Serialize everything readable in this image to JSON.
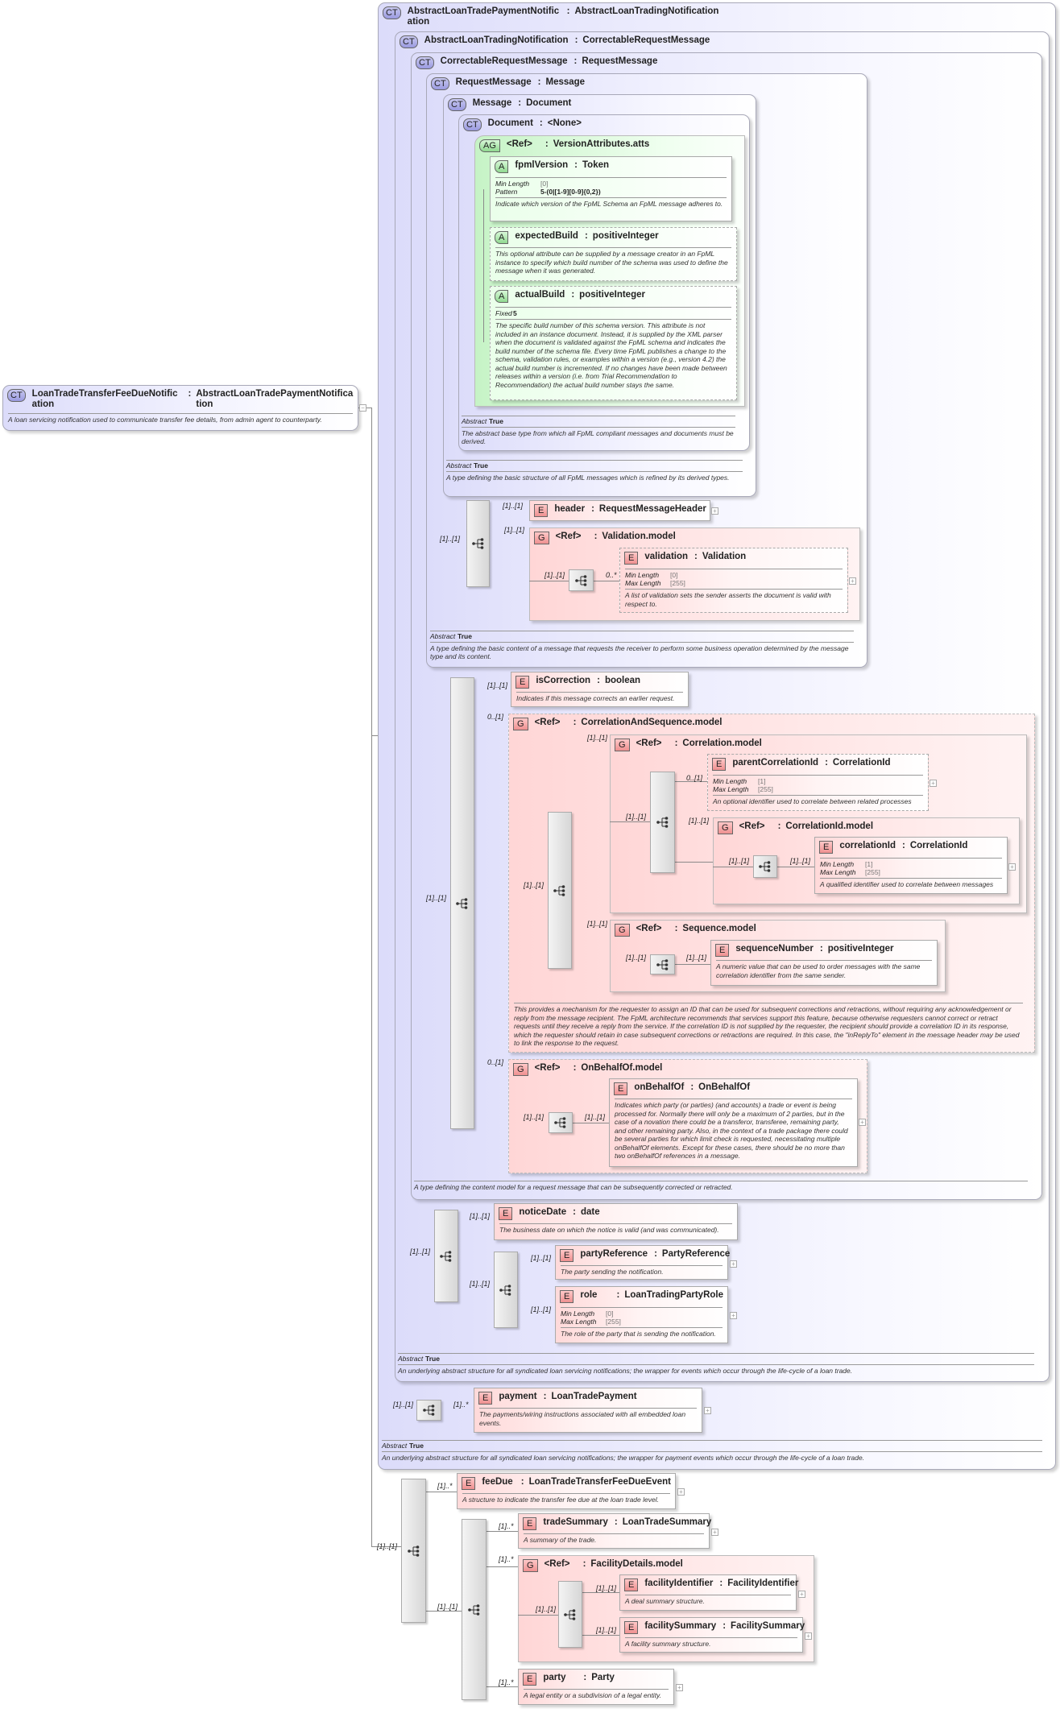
{
  "badges": {
    "ct": "CT",
    "e": "E",
    "g": "G",
    "a": "A",
    "ag": "AG"
  },
  "colon": ":",
  "plus": "+",
  "minus": "−",
  "root": {
    "name": "LoanTradeTransferFeeDueNotification",
    "type": "AbstractLoanTradePaymentNotification",
    "desc": "A loan servicing notification used to communicate transfer fee details, from admin agent to counterparty."
  },
  "abstract_label": "Abstract",
  "abstract_value": "True",
  "types": {
    "paymentNotification": {
      "name": "AbstractLoanTradePaymentNotification",
      "type": "AbstractLoanTradingNotification",
      "desc": "An underlying abstract structure for all syndicated loan servicing notifications; the wrapper for payment events which occur through the life-cycle of a loan trade."
    },
    "tradingNotification": {
      "name": "AbstractLoanTradingNotification",
      "type": "CorrectableRequestMessage",
      "desc": "An underlying abstract structure for all syndicated loan servicing notifications; the wrapper for events which occur through the life-cycle of a loan trade."
    },
    "correctable": {
      "name": "CorrectableRequestMessage",
      "type": "RequestMessage",
      "desc": "A type defining the content model for a request message that can be subsequently corrected or retracted."
    },
    "requestMessage": {
      "name": "RequestMessage",
      "type": "Message",
      "desc": "A type defining the basic content of a message that requests the receiver to perform some business operation determined by the message type and its content."
    },
    "message": {
      "name": "Message",
      "type": "Document",
      "desc": "A type defining the basic structure of all FpML messages which is refined by its derived types."
    },
    "document": {
      "name": "Document",
      "type": "<None>",
      "desc": "The abstract base type from which all FpML compliant messages and documents must be derived."
    }
  },
  "attrGroup": {
    "name": "<Ref>",
    "type": "VersionAttributes.atts"
  },
  "attributes": {
    "fpmlVersion": {
      "name": "fpmlVersion",
      "type": "Token",
      "minLengthLabel": "Min Length",
      "minLength": "[0]",
      "patternLabel": "Pattern",
      "pattern": "5-(0|[1-9][0-9]{0,2})",
      "desc": "Indicate which version of the FpML Schema an FpML message adheres to."
    },
    "expectedBuild": {
      "name": "expectedBuild",
      "type": "positiveInteger",
      "desc": "This optional attribute can be supplied by a message creator in an FpML instance to specify which build number of the schema was used to define the message when it was generated."
    },
    "actualBuild": {
      "name": "actualBuild",
      "type": "positiveInteger",
      "fixedLabel": "Fixed",
      "fixed": "5",
      "desc": "The specific build number of this schema version. This attribute is not included in an instance document. Instead, it is supplied by the XML parser when the document is validated against the FpML schema and indicates the build number of the schema file. Every time FpML publishes a change to the schema, validation rules, or examples within a version (e.g., version 4.2) the actual build number is incremented. If no changes have been made between releases within a version (i.e. from Trial Recommendation to Recommendation) the actual build number stays the same."
    }
  },
  "groups": {
    "validationModel": {
      "name": "<Ref>",
      "type": "Validation.model"
    },
    "corrAndSeq": {
      "name": "<Ref>",
      "type": "CorrelationAndSequence.model",
      "desc": "This provides a mechanism for the requester to assign an ID that can be used for subsequent corrections and retractions, without requiring any acknowledgement or reply from the message recipient. The FpML architecture recommends that services support this feature, because otherwise requesters cannot correct or retract requests until they receive a reply from the service. If the correlation ID is not supplied by the requester, the recipient should provide a correlation ID in its response, which the requester should retain in case subsequent corrections or retractions are required. In this case, the \"inReplyTo\" element in the message header may be used to link the response to the request."
    },
    "correlationModel": {
      "name": "<Ref>",
      "type": "Correlation.model"
    },
    "correlationIdModel": {
      "name": "<Ref>",
      "type": "CorrelationId.model"
    },
    "sequenceModel": {
      "name": "<Ref>",
      "type": "Sequence.model"
    },
    "onBehalfOfModel": {
      "name": "<Ref>",
      "type": "OnBehalfOf.model"
    },
    "facilityDetailsModel": {
      "name": "<Ref>",
      "type": "FacilityDetails.model"
    }
  },
  "elements": {
    "header": {
      "name": "header",
      "type": "RequestMessageHeader"
    },
    "validation": {
      "name": "validation",
      "type": "Validation",
      "minLengthLabel": "Min Length",
      "minLength": "[0]",
      "maxLengthLabel": "Max Length",
      "maxLength": "[255]",
      "desc": "A list of validation sets the sender asserts the document is valid with respect to."
    },
    "isCorrection": {
      "name": "isCorrection",
      "type": "boolean",
      "desc": "Indicates if this message corrects an earlier request."
    },
    "parentCorrelationId": {
      "name": "parentCorrelationId",
      "type": "CorrelationId",
      "minLengthLabel": "Min Length",
      "minLength": "[1]",
      "maxLengthLabel": "Max Length",
      "maxLength": "[255]",
      "desc": "An optional identifier used to correlate between related processes"
    },
    "correlationId": {
      "name": "correlationId",
      "type": "CorrelationId",
      "minLengthLabel": "Min Length",
      "minLength": "[1]",
      "maxLengthLabel": "Max Length",
      "maxLength": "[255]",
      "desc": "A qualified identifier used to correlate between messages"
    },
    "sequenceNumber": {
      "name": "sequenceNumber",
      "type": "positiveInteger",
      "desc": "A numeric value that can be used to order messages with the same correlation identifier from the same sender."
    },
    "onBehalfOf": {
      "name": "onBehalfOf",
      "type": "OnBehalfOf",
      "desc": "Indicates which party (or parties) (and accounts) a trade or event is being processed for. Normally there will only be a maximum of 2 parties, but in the case of a novation there could be a transferor, transferee, remaining party, and other remaining party. Also, in the context of a trade package there could be several parties for which limit check is requested, necessitating multiple onBehalfOf elements. Except for these cases, there should be no more than two onBehalfOf references in a message."
    },
    "noticeDate": {
      "name": "noticeDate",
      "type": "date",
      "desc": "The business date on which the notice is valid (and was communicated)."
    },
    "partyReference": {
      "name": "partyReference",
      "type": "PartyReference",
      "desc": "The party sending the notification."
    },
    "role": {
      "name": "role",
      "type": "LoanTradingPartyRole",
      "minLengthLabel": "Min Length",
      "minLength": "[0]",
      "maxLengthLabel": "Max Length",
      "maxLength": "[255]",
      "desc": "The role of the party that is sending the notification."
    },
    "payment": {
      "name": "payment",
      "type": "LoanTradePayment",
      "desc": "The payments/wiring instructions associated with all embedded loan events."
    },
    "feeDue": {
      "name": "feeDue",
      "type": "LoanTradeTransferFeeDueEvent",
      "desc": "A structure to indicate the transfer fee due at the loan trade level."
    },
    "tradeSummary": {
      "name": "tradeSummary",
      "type": "LoanTradeSummary",
      "desc": "A summary of the trade."
    },
    "facilityIdentifier": {
      "name": "facilityIdentifier",
      "type": "FacilityIdentifier",
      "desc": "A deal summary structure."
    },
    "facilitySummary": {
      "name": "facilitySummary",
      "type": "FacilitySummary",
      "desc": "A facility summary structure."
    },
    "party": {
      "name": "party",
      "type": "Party",
      "desc": "A legal entity or a subdivision of a legal entity."
    }
  },
  "card": [
    "[1]..[1]",
    "[1]..[1]",
    "[1]..[1]",
    "[1]..[1]",
    "0..*",
    "[1]..[1]",
    "[1]..[1]",
    "0..[1]",
    "[1]..[1]",
    "[1]..[1]",
    "[1]..[1]",
    "0..[1]",
    "[1]..[1]",
    "[1]..[1]",
    "[1]..[1]",
    "[1]..[1]",
    "[1]..[1]",
    "[1]..[1]",
    "0..[1]",
    "[1]..[1]",
    "[1]..[1]",
    "[1]..[1]",
    "[1]..[1]",
    "[1]..[1]",
    "[1]..[1]",
    "[1]..[1]",
    "[1]..[1]",
    "[1]..*",
    "[1]..[1]",
    "[1]..*",
    "[1]..[1]",
    "[1]..*",
    "[1]..*",
    "[1]..[1]",
    "[1]..[1]",
    "[1]..[1]",
    "[1]..*"
  ]
}
